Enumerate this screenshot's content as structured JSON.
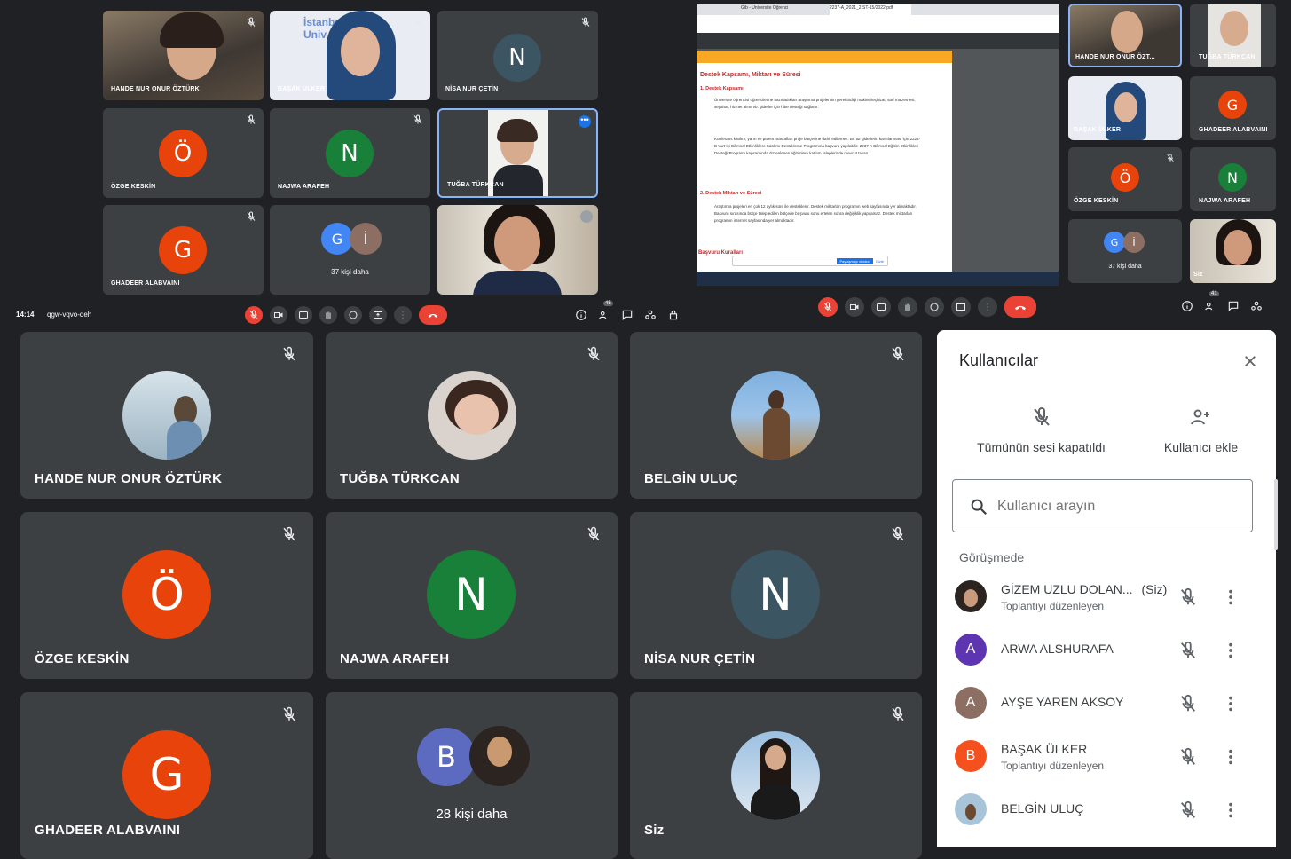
{
  "top_left": {
    "tiles": [
      {
        "name": "HANDE NUR ONUR ÖZTÜRK"
      },
      {
        "name": "BAŞAK ÜLKER",
        "banner": "İstanbul\nUniv"
      },
      {
        "name": "NİSA NUR ÇETİN",
        "letter": "N"
      },
      {
        "name": "ÖZGE KESKİN",
        "letter": "Ö"
      },
      {
        "name": "NAJWA ARAFEH",
        "letter": "N"
      },
      {
        "name": "TUĞBA TÜRKCAN"
      },
      {
        "name": "GHADEER ALABVAINI",
        "letter": "G"
      },
      {
        "name": "37 kişi daha",
        "letters": [
          "G",
          "İ"
        ]
      },
      {
        "name": ""
      }
    ],
    "time": "14:14",
    "code": "qgw-vqvo-qeh",
    "people_count": "45"
  },
  "screenshare": {
    "tab1": "Gib - Üniversite Öğrenci",
    "tab2": "2237-A_2021_2.ST-15/2022.pdf",
    "heading": "Destek Kapsamı, Miktarı ve Süresi",
    "sub1": "1.    Destek Kapsamı",
    "para1": "Üniversite öğrencisi öğrencilerine hazırladıkları araştırma projelerinin gerektirdiği makine/teçhizat, sarf malzemesi, seyahat, hizmet alımı vb. giderler için hibe desteği sağlanır.",
    "para2": "Konferans katılım, yarın ve patent masrafları proje bütçesine dahil edilemez. Bu tür giderlerin karşılanması için 2224-B Yurt İçi Bilimsel Etkinliklere Katılımı Destekleme Programına başvuru yapılabilir. 2237-A Bilimsel Eğitim Etkinlikleri Desteği Programı kapsamında düzenlenen eğitimlere katılım taleplerinde mevcut tavan",
    "sub2": "2.    Destek Miktarı ve Süresi",
    "para3": "Araştırma projeleri en çok 12 aylık süre ile desteklenir. Destek miktarları programın web sayfasında yer almaktadır. Başvuru sırasında bütçe talep edilen bütçede başvuru sonu ertelen sonra değişiklik yapılamaz. Destek miktarları programın internet sayfasında yer almaktadır.",
    "sub3": "Başvuru Kuralları",
    "share_btn": "Paylaşmayı durdur",
    "hide_btn": "Gizle"
  },
  "top_right": {
    "tiles": [
      {
        "name": "HANDE NUR ONUR ÖZT..."
      },
      {
        "name": "TUĞBA TÜRKCAN"
      },
      {
        "name": "BAŞAK ÜLKER"
      },
      {
        "name": "GHADEER ALABVAINI",
        "letter": "G"
      },
      {
        "name": "ÖZGE KESKİN",
        "letter": "Ö"
      },
      {
        "name": "NAJWA ARAFEH",
        "letter": "N"
      },
      {
        "name": "37 kişi daha",
        "letters": [
          "G",
          "İ"
        ]
      },
      {
        "name": "Siz"
      }
    ],
    "people_count": "41"
  },
  "main": {
    "tiles": [
      {
        "name": "HANDE NUR ONUR ÖZTÜRK"
      },
      {
        "name": "TUĞBA TÜRKCAN"
      },
      {
        "name": "BELGİN ULUÇ"
      },
      {
        "name": "ÖZGE KESKİN",
        "letter": "Ö"
      },
      {
        "name": "NAJWA ARAFEH",
        "letter": "N"
      },
      {
        "name": "NİSA NUR ÇETİN",
        "letter": "N"
      },
      {
        "name": "GHADEER ALABVAINI",
        "letter": "G"
      },
      {
        "name": "28 kişi daha",
        "letter": "B"
      },
      {
        "name": "Siz"
      }
    ]
  },
  "panel": {
    "title": "Kullanıcılar",
    "mute_all": "Tümünün sesi kapatıldı",
    "add_user": "Kullanıcı ekle",
    "search_placeholder": "Kullanıcı arayın",
    "section": "Görüşmede",
    "people": [
      {
        "name": "GİZEM UZLU DOLAN...",
        "you": "(Siz)",
        "role": "Toplantıyı düzenleyen",
        "letter": ""
      },
      {
        "name": "ARWA ALSHURAFA",
        "role": "",
        "letter": "A"
      },
      {
        "name": "AYŞE YAREN AKSOY",
        "role": "",
        "letter": "A"
      },
      {
        "name": "BAŞAK ÜLKER",
        "role": "Toplantıyı düzenleyen",
        "letter": "B"
      },
      {
        "name": "BELGİN ULUÇ",
        "role": "",
        "letter": ""
      }
    ]
  },
  "colors": {
    "background": "#202124",
    "tile": "#3c4043",
    "orange": "#e8430a",
    "green": "#188038",
    "slate": "#3b5562",
    "purple": "#5e35b1",
    "brown": "#8d6e63",
    "blue": "#4285f4",
    "red": "#ea4335"
  }
}
